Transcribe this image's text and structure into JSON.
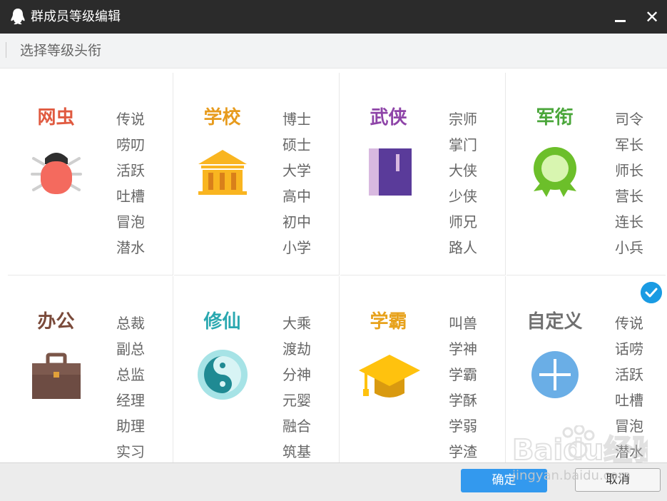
{
  "window": {
    "title": "群成员等级编辑",
    "subtitle": "选择等级头衔"
  },
  "categories": [
    {
      "name": "网虫",
      "color": "#e05a40",
      "icon": "bug-icon",
      "levels": [
        "传说",
        "唠叨",
        "活跃",
        "吐槽",
        "冒泡",
        "潜水"
      ]
    },
    {
      "name": "学校",
      "color": "#e79b1d",
      "icon": "school-building-icon",
      "levels": [
        "博士",
        "硕士",
        "大学",
        "高中",
        "初中",
        "小学"
      ]
    },
    {
      "name": "武侠",
      "color": "#8e44a8",
      "icon": "martial-book-icon",
      "levels": [
        "宗师",
        "掌门",
        "大侠",
        "少侠",
        "师兄",
        "路人"
      ]
    },
    {
      "name": "军衔",
      "color": "#4aa63a",
      "icon": "military-medal-icon",
      "levels": [
        "司令",
        "军长",
        "师长",
        "营长",
        "连长",
        "小兵"
      ]
    },
    {
      "name": "办公",
      "color": "#7a4a3a",
      "icon": "briefcase-icon",
      "levels": [
        "总裁",
        "副总",
        "总监",
        "经理",
        "助理",
        "实习"
      ]
    },
    {
      "name": "修仙",
      "color": "#2aa8b0",
      "icon": "yin-yang-icon",
      "levels": [
        "大乘",
        "渡劫",
        "分神",
        "元婴",
        "融合",
        "筑基"
      ]
    },
    {
      "name": "学霸",
      "color": "#e7a21d",
      "icon": "graduation-cap-icon",
      "levels": [
        "叫兽",
        "学神",
        "学霸",
        "学酥",
        "学弱",
        "学渣"
      ]
    },
    {
      "name": "自定义",
      "color": "#707070",
      "icon": "plus-circle-icon",
      "levels": [
        "传说",
        "话唠",
        "活跃",
        "吐槽",
        "冒泡",
        "潜水"
      ]
    }
  ],
  "selected_category": "自定义",
  "buttons": {
    "ok": "确定",
    "cancel": "取消"
  },
  "watermark": {
    "brand": "Baidu经验",
    "url": "jingyan.baidu.com"
  },
  "colors": {
    "titlebar": "#2b2b2b",
    "accent": "#3399ee",
    "check": "#1a9be3"
  }
}
